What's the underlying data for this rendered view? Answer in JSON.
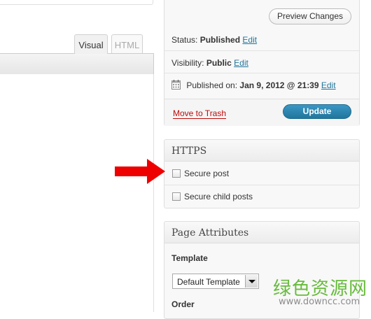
{
  "editor": {
    "tabs": [
      {
        "label": "Visual",
        "active": true
      },
      {
        "label": "HTML",
        "active": false
      }
    ]
  },
  "publish_box": {
    "preview_label": "Preview Changes",
    "status_label": "Status:",
    "status_value": "Published",
    "visibility_label": "Visibility:",
    "visibility_value": "Public",
    "published_label": "Published on:",
    "published_value": "Jan 9, 2012 @ 21:39",
    "edit_label": "Edit",
    "trash_label": "Move to Trash",
    "update_label": "Update"
  },
  "https_box": {
    "title": "HTTPS",
    "options": [
      {
        "label": "Secure post",
        "checked": false
      },
      {
        "label": "Secure child posts",
        "checked": false
      }
    ]
  },
  "attributes_box": {
    "title": "Page Attributes",
    "template_label": "Template",
    "template_value": "Default Template",
    "order_label": "Order"
  },
  "watermark": {
    "text": "绿色资源网",
    "url": "www.downcc.com"
  },
  "colors": {
    "link": "#21759b",
    "trash": "#bc0b0b",
    "update_button": "#21759b",
    "arrow": "#ee0000",
    "watermark": "#5fb832"
  }
}
